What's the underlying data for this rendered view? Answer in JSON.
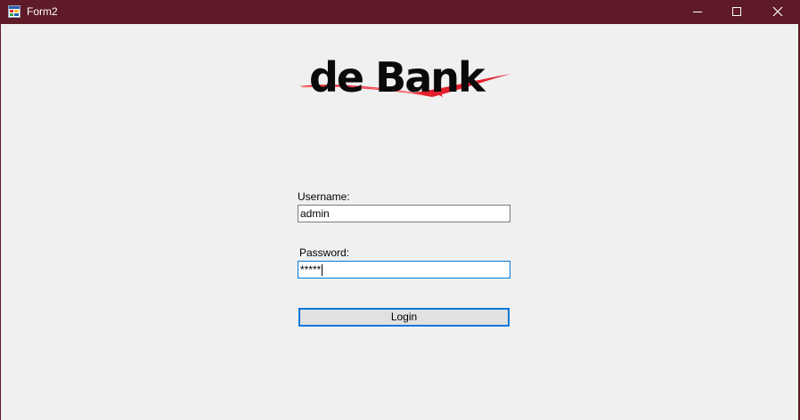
{
  "window": {
    "title": "Form2",
    "colors": {
      "titlebar": "#5e1a26",
      "client": "#f0f0f0",
      "accent": "#0078d7",
      "logo_red": "#e3202b"
    }
  },
  "titlebar_buttons": {
    "minimize_icon": "minimize-icon",
    "maximize_icon": "maximize-icon",
    "close_icon": "close-icon"
  },
  "logo": {
    "text": "de Bank"
  },
  "form": {
    "username_label": "Username:",
    "username_value": "admin",
    "password_label": "Password:",
    "password_value": "*****",
    "login_label": "Login"
  }
}
